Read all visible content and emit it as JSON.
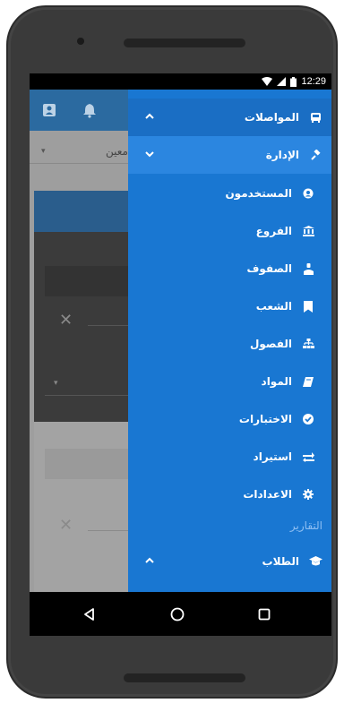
{
  "status_bar": {
    "time": "12:29"
  },
  "background": {
    "select_text": "معين",
    "clear_symbol": "✕"
  },
  "drawer": {
    "items": [
      {
        "label": "المواصلات",
        "icon": "bus-icon",
        "expanded": false
      },
      {
        "label": "الإدارة",
        "icon": "gavel-icon",
        "expanded": true
      },
      {
        "label": "المستخدمون",
        "icon": "user-circle-icon"
      },
      {
        "label": "الفروع",
        "icon": "institution-icon"
      },
      {
        "label": "الصفوف",
        "icon": "user-tie-icon"
      },
      {
        "label": "الشعب",
        "icon": "bookmark-icon"
      },
      {
        "label": "الفصول",
        "icon": "sitemap-icon"
      },
      {
        "label": "المواد",
        "icon": "book-icon"
      },
      {
        "label": "الاختبارات",
        "icon": "check-circle-icon"
      },
      {
        "label": "استيراد",
        "icon": "exchange-icon"
      },
      {
        "label": "الاعدادات",
        "icon": "gear-icon"
      }
    ],
    "section_header": "التقارير",
    "students": {
      "label": "الطلاب",
      "icon": "graduation-cap-icon",
      "expanded": false
    }
  },
  "colors": {
    "drawer": "#1977d2",
    "drawer_active": "#2b86e0",
    "appbar": "#2b6aa0",
    "section_header": "#8fbff2"
  }
}
